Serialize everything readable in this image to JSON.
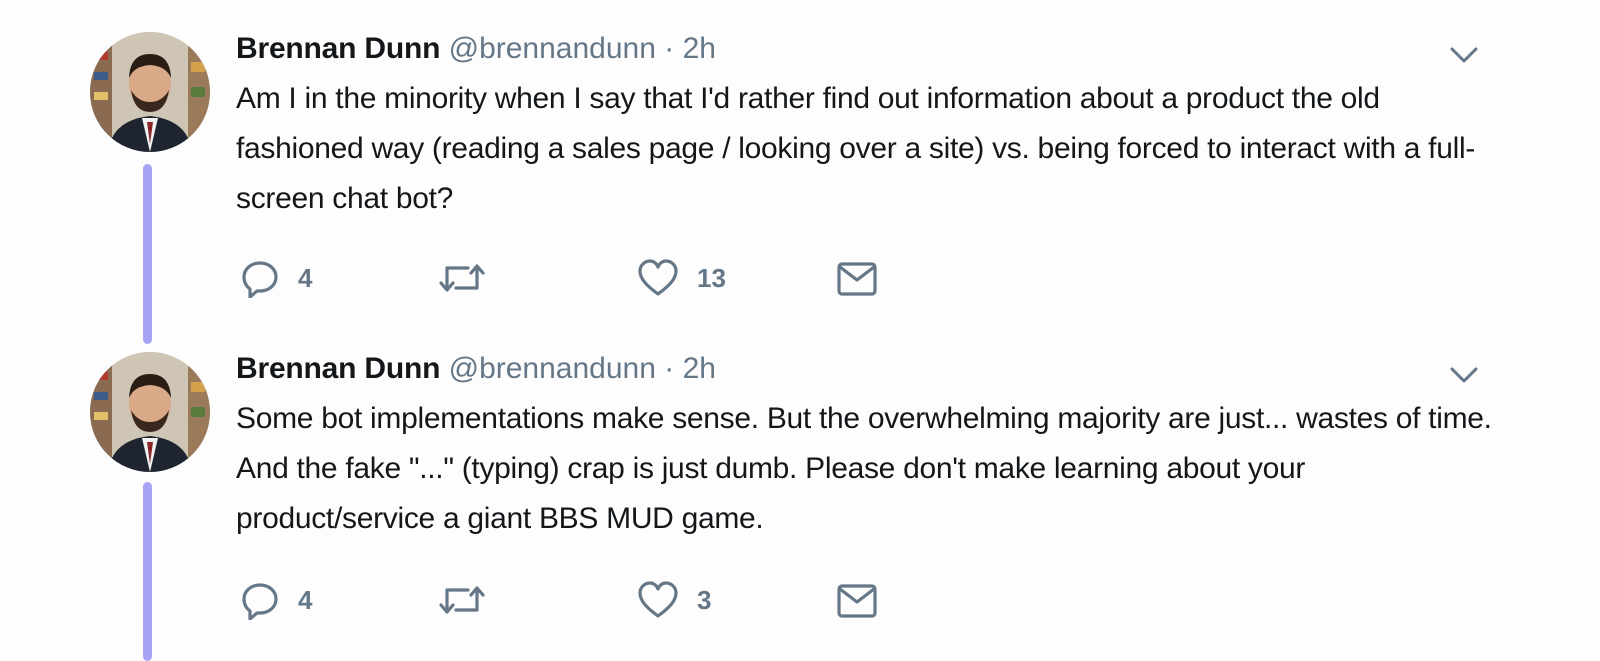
{
  "tweets": [
    {
      "name": "Brennan Dunn",
      "handle": "@brennandunn",
      "separator": "·",
      "time": "2h",
      "text": "Am I in the minority when I say that I'd rather find out information about a product the old fashioned way (reading a sales page / looking over a site) vs. being forced to interact with a full-screen chat bot?",
      "reply_count": "4",
      "retweet_count": "",
      "like_count": "13"
    },
    {
      "name": "Brennan Dunn",
      "handle": "@brennandunn",
      "separator": "·",
      "time": "2h",
      "text": "Some bot implementations make sense. But the overwhelming majority are just... wastes of time. And the fake \"...\" (typing) crap is just dumb. Please don't make learning about your product/service a giant BBS MUD game.",
      "reply_count": "4",
      "retweet_count": "",
      "like_count": "3"
    }
  ],
  "icons": {
    "reply": "reply-icon",
    "retweet": "retweet-icon",
    "like": "heart-icon",
    "dm": "envelope-icon",
    "caret": "chevron-down-icon"
  },
  "colors": {
    "thread_line": "#a8a4f5",
    "icon_gray": "#657786",
    "text": "#14171a"
  }
}
